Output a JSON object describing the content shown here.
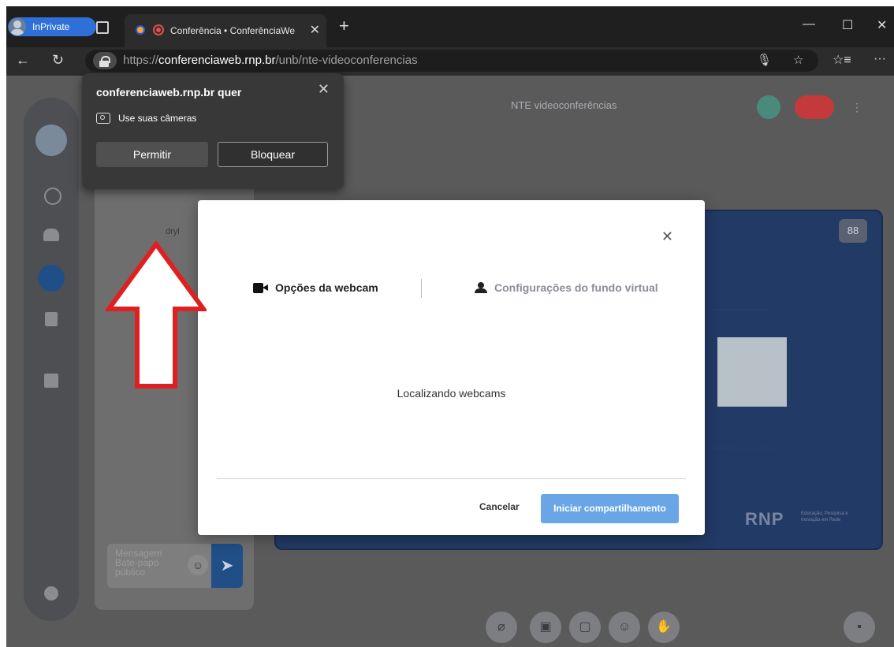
{
  "browser": {
    "inprivate_label": "InPrivate",
    "tab_title": "Conferência • ConferênciaWe",
    "tab_close": "✕",
    "new_tab": "+",
    "url_prefix": "https://",
    "url_host": "conferenciaweb.rnp.br",
    "url_path": "/unb/nte-videoconferencias"
  },
  "permission_popup": {
    "title": "conferenciaweb.rnp.br quer",
    "request": "Use suas câmeras",
    "allow_label": "Permitir",
    "block_label": "Bloquear",
    "close": "✕"
  },
  "meeting": {
    "title": "NTE videoconferências",
    "chat_placeholder": "Mensagem Bate-papo público",
    "chat_name_fragment": "dryl",
    "brand": "RNP",
    "brand_sub": "Educação, Pesquisa e Inovação em Rede"
  },
  "modal": {
    "tab_webcam": "Opções da webcam",
    "tab_background": "Configurações do fundo virtual",
    "status": "Localizando webcams",
    "cancel_label": "Cancelar",
    "start_label": "Iniciar compartilhamento",
    "close": "✕"
  },
  "colors": {
    "accent_blue": "#6aa6e6",
    "inprivate_blue": "#2f6fd8",
    "arrow_red": "#e02020",
    "leave_red": "#c43a3a"
  }
}
